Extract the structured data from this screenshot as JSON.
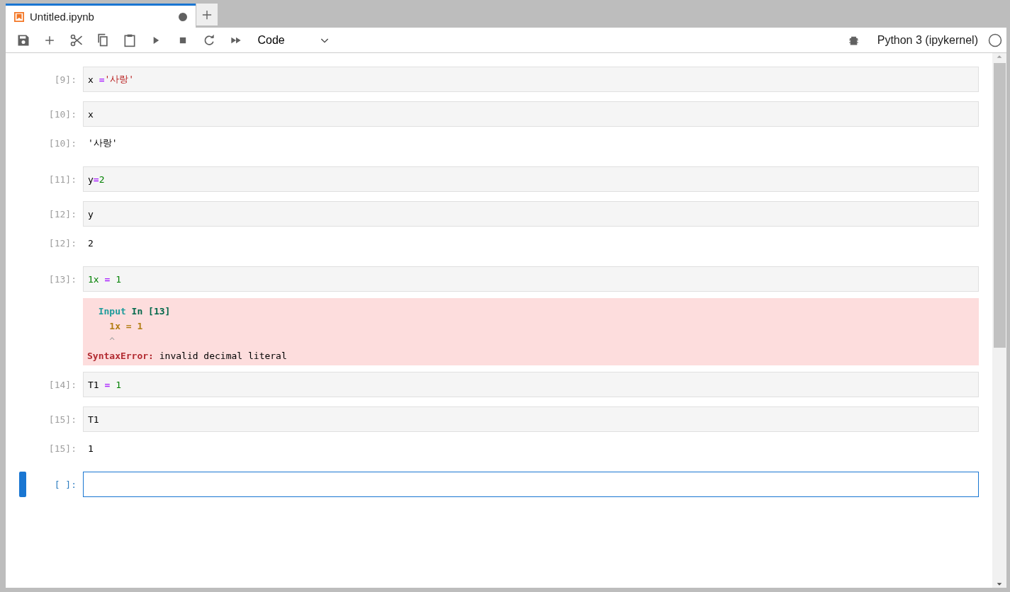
{
  "tab": {
    "title": "Untitled.ipynb",
    "unsaved": true,
    "selected": true
  },
  "toolbar": {
    "cell_type": "Code",
    "kernel": "Python 3 (ipykernel)",
    "kernel_busy": false
  },
  "cells": [
    {
      "prompt": "[9]:",
      "selected": false,
      "code": [
        {
          "text": "x ",
          "kind": "var"
        },
        {
          "text": "=",
          "kind": "op"
        },
        {
          "text": "'사랑'",
          "kind": "str"
        }
      ]
    },
    {
      "prompt": "[10]:",
      "selected": false,
      "code": [
        {
          "text": "x",
          "kind": "var"
        }
      ],
      "output": {
        "prompt": "[10]:",
        "text": "'사랑'"
      }
    },
    {
      "prompt": "[11]:",
      "selected": false,
      "code": [
        {
          "text": "y",
          "kind": "var"
        },
        {
          "text": "=",
          "kind": "op"
        },
        {
          "text": "2",
          "kind": "num"
        }
      ]
    },
    {
      "prompt": "[12]:",
      "selected": false,
      "code": [
        {
          "text": "y",
          "kind": "var"
        }
      ],
      "output": {
        "prompt": "[12]:",
        "text": "2"
      }
    },
    {
      "prompt": "[13]:",
      "selected": false,
      "code": [
        {
          "text": "1x ",
          "kind": "num"
        },
        {
          "text": "=",
          "kind": "op"
        },
        {
          "text": " 1",
          "kind": "num"
        }
      ],
      "error": [
        [
          {
            "text": "  Input",
            "kind": "cyan"
          },
          {
            "text": " In [13]",
            "kind": "green"
          }
        ],
        [
          {
            "text": "    1x = 1",
            "kind": "yellow"
          }
        ],
        [
          {
            "text": "    ^",
            "kind": "grey"
          }
        ],
        [
          {
            "text": "SyntaxError:",
            "kind": "red"
          },
          {
            "text": " invalid decimal literal",
            "kind": "plain"
          }
        ]
      ]
    },
    {
      "prompt": "[14]:",
      "selected": false,
      "code": [
        {
          "text": "T1 ",
          "kind": "var"
        },
        {
          "text": "=",
          "kind": "op"
        },
        {
          "text": " 1",
          "kind": "num"
        }
      ]
    },
    {
      "prompt": "[15]:",
      "selected": false,
      "code": [
        {
          "text": "T1",
          "kind": "var"
        }
      ],
      "output": {
        "prompt": "[15]:",
        "text": "1"
      }
    },
    {
      "prompt": "[ ]:",
      "selected": true
    }
  ]
}
